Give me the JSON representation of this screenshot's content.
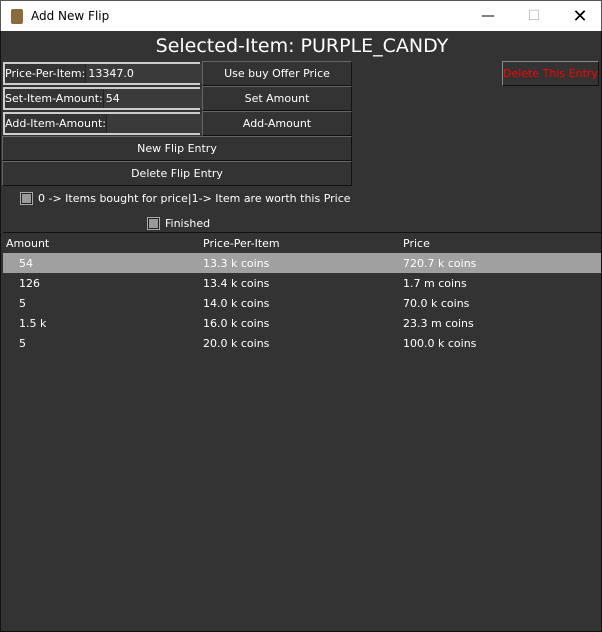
{
  "window": {
    "title": "Add New Flip"
  },
  "heading": "Selected-Item: PURPLE_CANDY",
  "fields": [
    {
      "label": "Price-Per-Item:",
      "value": "13347.0"
    },
    {
      "label": "Set-Item-Amount:",
      "value": "54"
    },
    {
      "label": "Add-Item-Amount:",
      "value": ""
    }
  ],
  "buttons": {
    "use_buy_offer": "Use buy Offer Price",
    "set_amount": "Set Amount",
    "add_amount": "Add-Amount",
    "new_flip": "New Flip Entry",
    "delete_flip": "Delete Flip Entry",
    "delete_entry": "Delete This Entry"
  },
  "checkboxes": {
    "mode": "0 -> Items bought for price|1-> Item are worth this Price",
    "finished": "Finished"
  },
  "table": {
    "headers": [
      "Amount",
      "Price-Per-Item",
      "Price"
    ],
    "rows": [
      [
        "54",
        "13.3 k coins",
        "720.7 k coins"
      ],
      [
        "126",
        "13.4 k coins",
        "1.7 m coins"
      ],
      [
        "5",
        "14.0 k coins",
        "70.0 k coins"
      ],
      [
        "1.5 k",
        "16.0 k coins",
        "23.3 m coins"
      ],
      [
        "5",
        "20.0 k coins",
        "100.0 k coins"
      ]
    ]
  },
  "colors": {
    "danger": "#ff0000",
    "selected_row": "#a0a0a0"
  }
}
